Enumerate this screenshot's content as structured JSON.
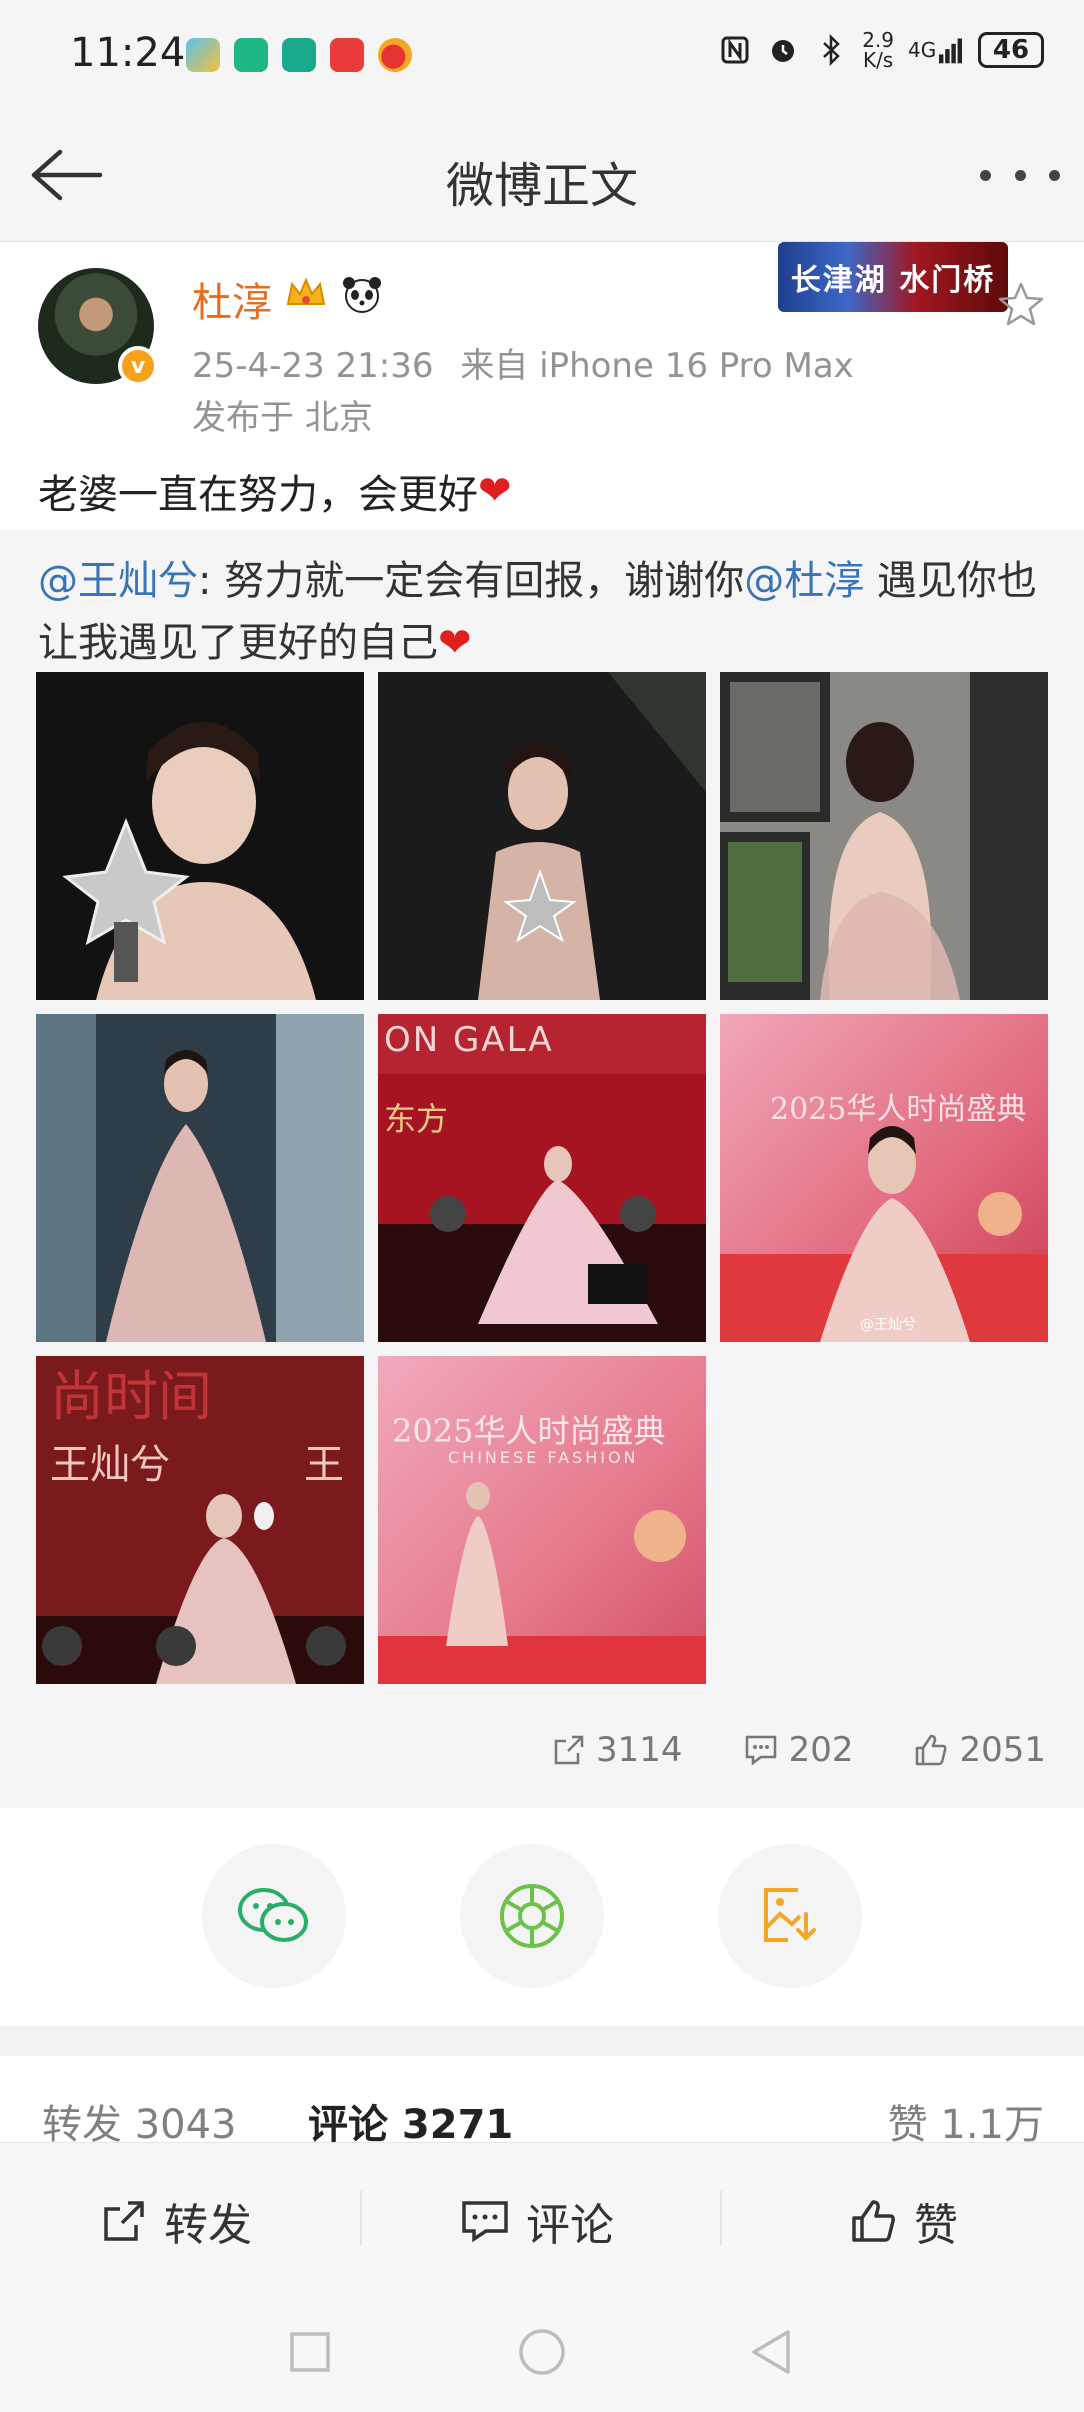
{
  "status_bar": {
    "time": "11:24",
    "network_speed_value": "2.9",
    "network_speed_unit": "K/s",
    "signal_label": "4G",
    "battery": "46",
    "app_icons": [
      "game-app-icon",
      "sport-app-icon-1",
      "sport-app-icon-2",
      "red-app-icon",
      "weibo-app-icon"
    ]
  },
  "nav": {
    "title": "微博正文"
  },
  "post": {
    "author": "杜淳",
    "timestamp": "25-4-23 21:36",
    "source": "来自 iPhone 16 Pro Max",
    "location": "发布于 北京",
    "banner_badge_text": "长津湖 水门桥",
    "text": "老婆一直在努力，会更好",
    "heart_emoji": "❤"
  },
  "repost": {
    "author_mention": "@王灿兮",
    "text_part1": ": 努力就一定会有回报，谢谢你",
    "mention2": "@杜淳",
    "text_part2": " 遇见你也让我遇见了更好的自己",
    "heart_emoji": "❤",
    "images": [
      {
        "name": "award-photo-1",
        "bg": "#121212",
        "accent": "#e7c9b8"
      },
      {
        "name": "award-photo-2",
        "bg": "#161616",
        "accent": "#d9b6a6"
      },
      {
        "name": "backless-dress-photo",
        "bg": "#7a7a78",
        "accent": "#e5c8c0"
      },
      {
        "name": "window-dress-photo",
        "bg": "#2d3a44",
        "accent": "#ddb9b6"
      },
      {
        "name": "fashion-gala-stage-photo",
        "bg": "#a4141f",
        "accent": "#f0c8d0"
      },
      {
        "name": "red-carpet-photo-1",
        "bg": "#e8707f",
        "accent": "#f3cfc8"
      },
      {
        "name": "red-carpet-award-photo",
        "bg": "#6f1518",
        "accent": "#e8c3c0"
      },
      {
        "name": "red-carpet-photo-2",
        "bg": "#e37a8c",
        "accent": "#f0d0ca"
      }
    ],
    "image_texts": {
      "img5": "ON GALA",
      "img5b": "东方",
      "img6": "2025华人时尚盛典",
      "img6_wm": "@王灿兮",
      "img7": "尚时间",
      "img7b": "王灿兮",
      "img7c": "王",
      "img8": "2025华人时尚盛典",
      "img8b": "CHINESE FASHION"
    },
    "reposts": "3114",
    "comments": "202",
    "likes": "2051"
  },
  "share": {
    "buttons": [
      "wechat-icon",
      "moments-icon",
      "save-image-icon"
    ],
    "colors": {
      "wechat": "#2aae67",
      "moments": "#6cc14a",
      "save": "#f5a623"
    }
  },
  "tabs": {
    "repost": "转发 3043",
    "comment": "评论 3271",
    "like": "赞 1.1万"
  },
  "bottom_bar": {
    "repost": "转发",
    "comment": "评论",
    "like": "赞"
  }
}
